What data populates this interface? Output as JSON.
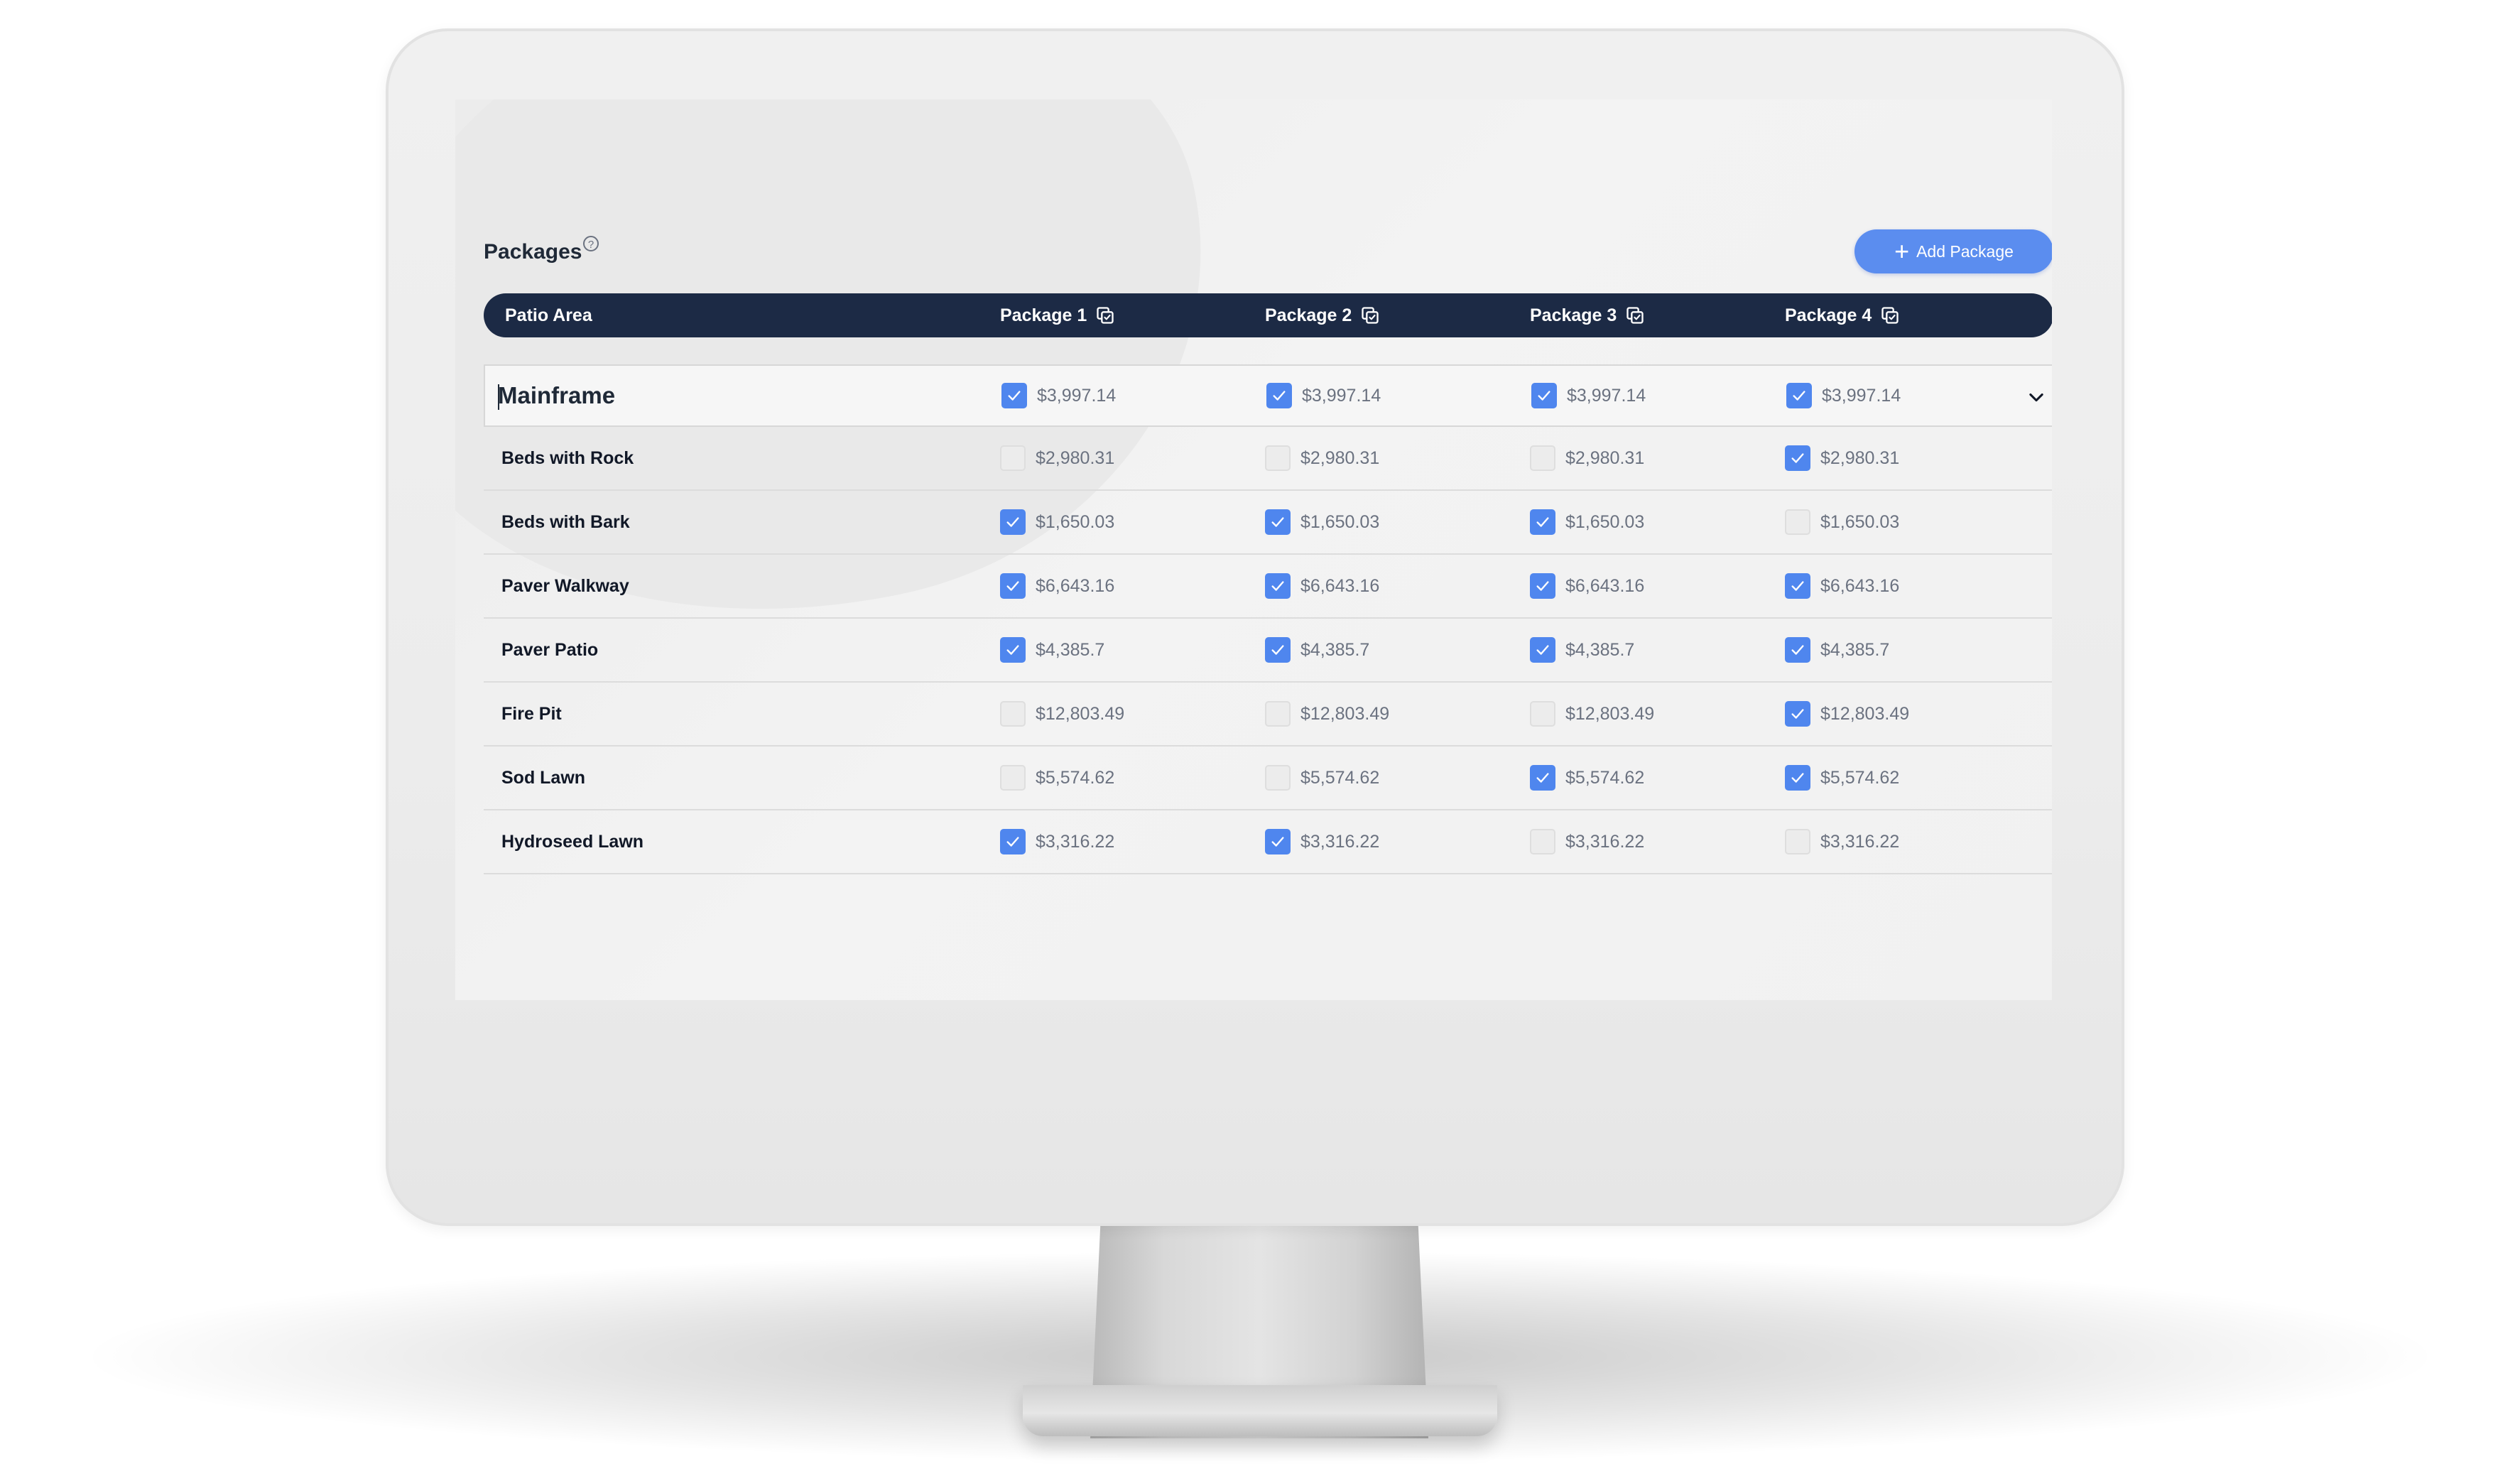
{
  "packages": {
    "title": "Packages",
    "help_icon": "help-circle-icon",
    "add_button_label": "Add Package",
    "add_icon": "plus-icon"
  },
  "table": {
    "area_header": "Patio Area",
    "package_headers": [
      "Package 1",
      "Package 2",
      "Package 3",
      "Package 4"
    ],
    "copy_icon": "copy-icon",
    "group": {
      "label": "Mainframe",
      "price": "$3,997.14",
      "checked": [
        true,
        true,
        true,
        true
      ],
      "expand_icon": "chevron-down-icon"
    },
    "rows": [
      {
        "label": "Beds with Rock",
        "price": "$2,980.31",
        "checked": [
          false,
          false,
          false,
          true
        ]
      },
      {
        "label": "Beds with Bark",
        "price": "$1,650.03",
        "checked": [
          true,
          true,
          true,
          false
        ]
      },
      {
        "label": "Paver Walkway",
        "price": "$6,643.16",
        "checked": [
          true,
          true,
          true,
          true
        ]
      },
      {
        "label": "Paver Patio",
        "price": "$4,385.7",
        "checked": [
          true,
          true,
          true,
          true
        ]
      },
      {
        "label": "Fire Pit",
        "price": "$12,803.49",
        "checked": [
          false,
          false,
          false,
          true
        ]
      },
      {
        "label": "Sod Lawn",
        "price": "$5,574.62",
        "checked": [
          false,
          false,
          true,
          true
        ]
      },
      {
        "label": "Hydroseed Lawn",
        "price": "$3,316.22",
        "checked": [
          true,
          true,
          false,
          false
        ]
      }
    ]
  },
  "colors": {
    "accent": "#5b8def",
    "checkbox_on": "#4f86ee",
    "header_bg": "#1c2a45"
  }
}
